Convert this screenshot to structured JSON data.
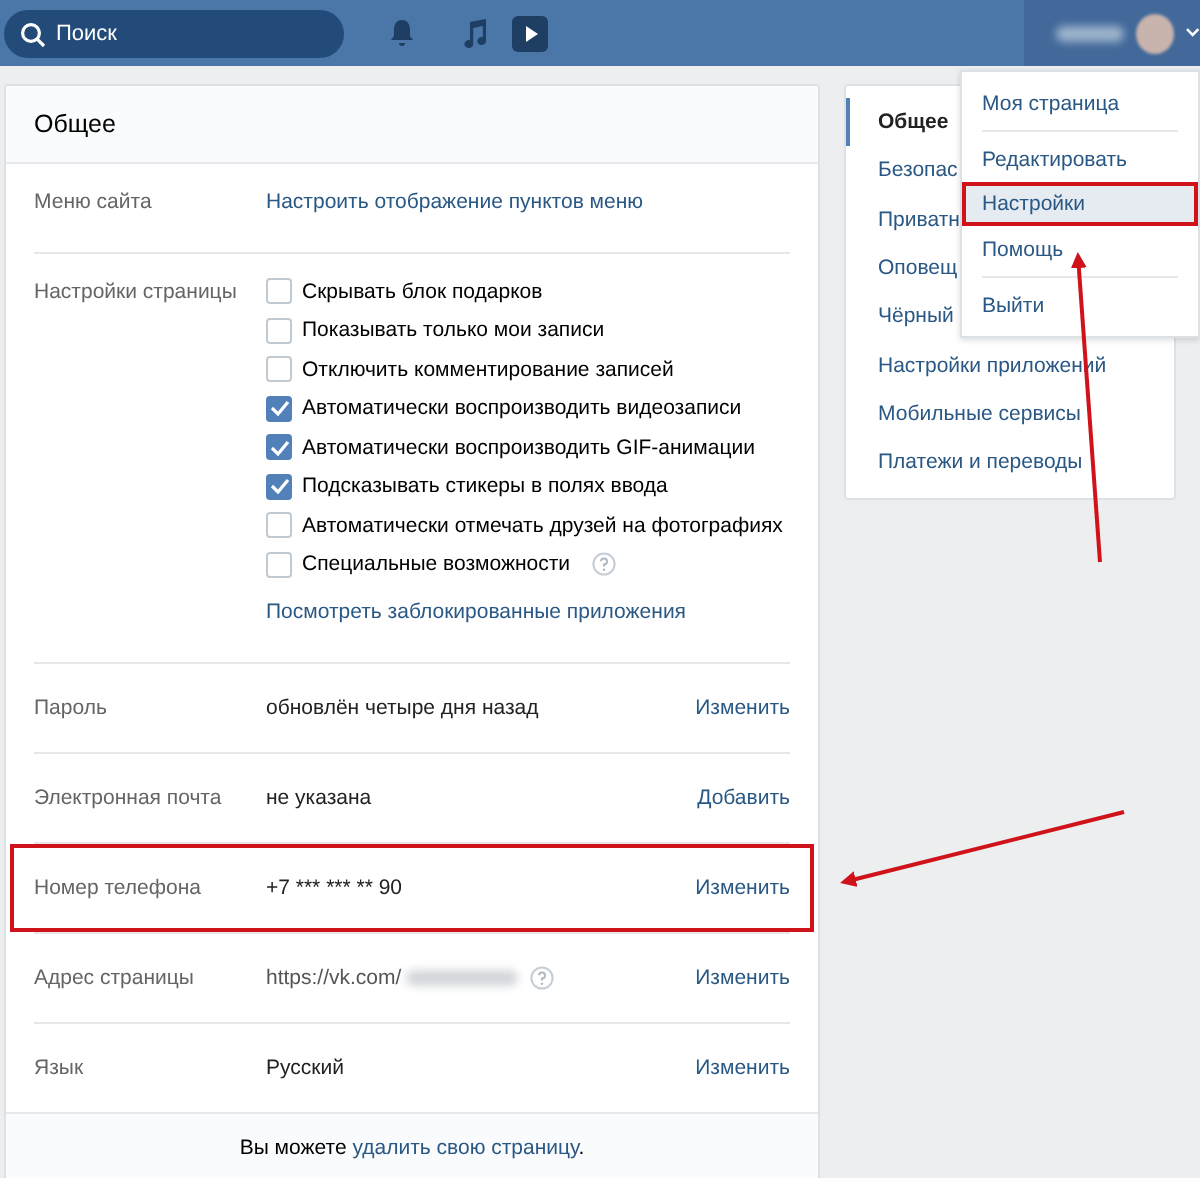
{
  "header": {
    "search": {
      "placeholder": "Поиск"
    }
  },
  "panel": {
    "title": "Общее",
    "site_menu": {
      "label": "Меню сайта",
      "link": "Настроить отображение пунктов меню"
    },
    "page_settings": {
      "label": "Настройки страницы",
      "options": [
        {
          "label": "Скрывать блок подарков",
          "checked": false,
          "help": false
        },
        {
          "label": "Показывать только мои записи",
          "checked": false,
          "help": false
        },
        {
          "label": "Отключить комментирование записей",
          "checked": false,
          "help": false
        },
        {
          "label": "Автоматически воспроизводить видеозаписи",
          "checked": true,
          "help": false
        },
        {
          "label": "Автоматически воспроизводить GIF-анимации",
          "checked": true,
          "help": false
        },
        {
          "label": "Подсказывать стикеры в полях ввода",
          "checked": true,
          "help": false
        },
        {
          "label": "Автоматически отмечать друзей на фотографиях",
          "checked": false,
          "help": false
        },
        {
          "label": "Специальные возможности",
          "checked": false,
          "help": true
        }
      ],
      "link": "Посмотреть заблокированные приложения"
    },
    "rows": [
      {
        "label": "Пароль",
        "value": "обновлён четыре дня назад",
        "kind": "text",
        "action": "Изменить",
        "highlighted": false
      },
      {
        "label": "Электронная почта",
        "value": "не указана",
        "kind": "text",
        "action": "Добавить",
        "highlighted": false
      },
      {
        "label": "Номер телефона",
        "value": "+7 *** *** ** 90",
        "kind": "text",
        "action": "Изменить",
        "highlighted": true
      },
      {
        "label": "Адрес страницы",
        "value": "https://vk.com/",
        "kind": "url",
        "action": "Изменить",
        "highlighted": false
      },
      {
        "label": "Язык",
        "value": "Русский",
        "kind": "text",
        "action": "Изменить",
        "highlighted": false
      }
    ],
    "footer": {
      "before": "Вы можете",
      "link": "удалить свою страницу",
      "after": "."
    }
  },
  "side_menu": [
    {
      "label": "Общее",
      "selected": true
    },
    {
      "label": "Безопас",
      "selected": false
    },
    {
      "label": "Приватн",
      "selected": false
    },
    {
      "label": "Оповещ",
      "selected": false
    },
    {
      "label": "Чёрный",
      "selected": false
    },
    {
      "label": "Настройки приложений",
      "selected": false
    },
    {
      "label": "Мобильные сервисы",
      "selected": false
    },
    {
      "label": "Платежи и переводы",
      "selected": false
    }
  ],
  "dropdown": [
    {
      "label": "Моя страница",
      "selected": false,
      "divider_after": true
    },
    {
      "label": "Редактировать",
      "selected": false,
      "divider_after": false
    },
    {
      "label": "Настройки",
      "selected": true,
      "divider_after": false
    },
    {
      "label": "Помощь",
      "selected": false,
      "divider_after": true
    },
    {
      "label": "Выйти",
      "selected": false,
      "divider_after": false
    }
  ]
}
